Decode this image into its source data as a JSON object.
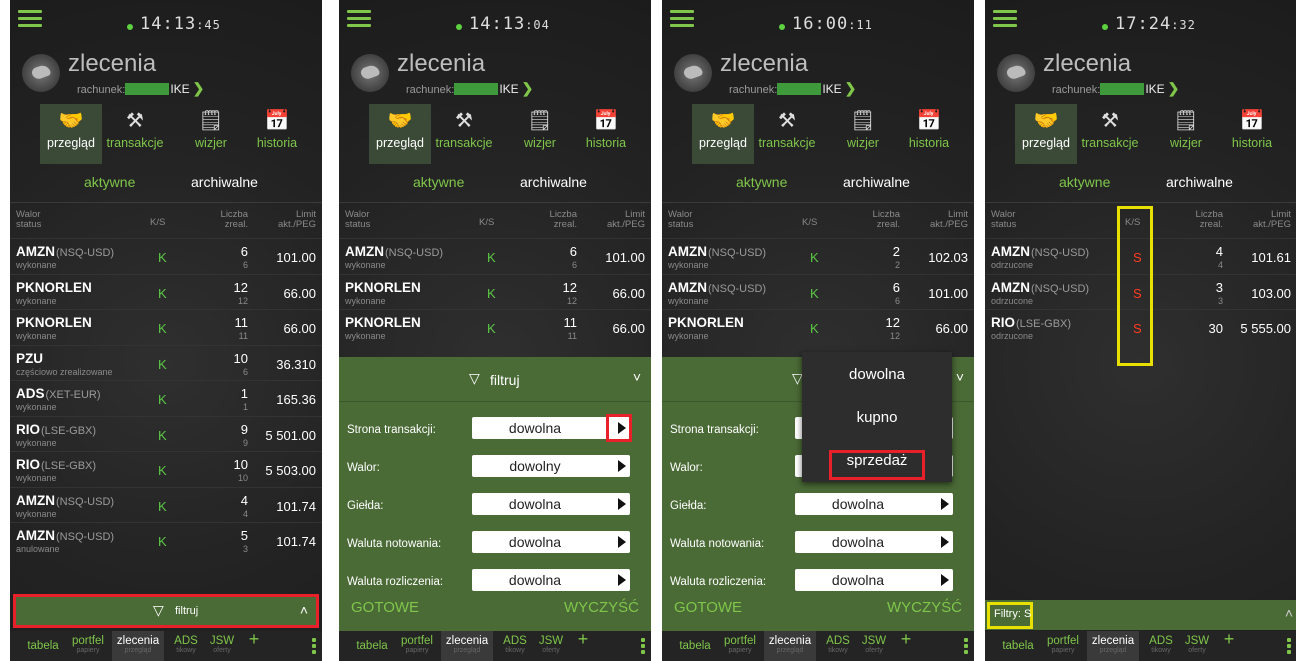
{
  "common": {
    "app_title": "zlecenia",
    "account_label": "rachunek:",
    "account_suffix": "IKE",
    "tabs": [
      {
        "label": "przegląd",
        "icon": "handshake-icon"
      },
      {
        "label": "transakcje",
        "icon": "gavel-icon"
      },
      {
        "label": "wizjer",
        "icon": "document-clock-icon"
      },
      {
        "label": "historia",
        "icon": "calendar-icon"
      }
    ],
    "sub_active": "aktywne",
    "sub_inactive": "archiwalne",
    "headers": {
      "walor": "Walor",
      "status": "status",
      "ks": "K/S",
      "liczba": "Liczba",
      "zreal": "zreal.",
      "limit": "Limit",
      "akt_peg": "akt./PEG"
    },
    "bottom_nav": [
      {
        "main": "tabela",
        "sub": ""
      },
      {
        "main": "portfel",
        "sub": "papiery"
      },
      {
        "main": "zlecenia",
        "sub": "przegląd"
      },
      {
        "main": "ADS",
        "sub": "tikowy"
      },
      {
        "main": "JSW",
        "sub": "oferty"
      },
      {
        "main": "+",
        "sub": ""
      }
    ],
    "filter_label": "filtruj",
    "colors": {
      "accent": "#7fc64a",
      "sell": "#ff3d1f",
      "highlight_red": "#e8202a",
      "highlight_yellow": "#e8e000",
      "filter_bar": "#4a6a36"
    }
  },
  "panels": [
    {
      "clock_main": "14:13",
      "clock_sec": ":45",
      "rows": [
        {
          "name": "AMZN",
          "exchange": "(NSQ-USD)",
          "status": "wykonane",
          "ks": "K",
          "qty": "6",
          "qty_real": "6",
          "limit": "101.00"
        },
        {
          "name": "PKNORLEN",
          "exchange": "",
          "status": "wykonane",
          "ks": "K",
          "qty": "12",
          "qty_real": "12",
          "limit": "66.00"
        },
        {
          "name": "PKNORLEN",
          "exchange": "",
          "status": "wykonane",
          "ks": "K",
          "qty": "11",
          "qty_real": "11",
          "limit": "66.00"
        },
        {
          "name": "PZU",
          "exchange": "",
          "status": "częściowo zrealizowane",
          "ks": "K",
          "qty": "10",
          "qty_real": "6",
          "limit": "36.310"
        },
        {
          "name": "ADS",
          "exchange": "(XET-EUR)",
          "status": "wykonane",
          "ks": "K",
          "qty": "1",
          "qty_real": "1",
          "limit": "165.36"
        },
        {
          "name": "RIO",
          "exchange": "(LSE-GBX)",
          "status": "wykonane",
          "ks": "K",
          "qty": "9",
          "qty_real": "9",
          "limit": "5 501.00"
        },
        {
          "name": "RIO",
          "exchange": "(LSE-GBX)",
          "status": "wykonane",
          "ks": "K",
          "qty": "10",
          "qty_real": "10",
          "limit": "5 503.00"
        },
        {
          "name": "AMZN",
          "exchange": "(NSQ-USD)",
          "status": "wykonane",
          "ks": "K",
          "qty": "4",
          "qty_real": "4",
          "limit": "101.74"
        },
        {
          "name": "AMZN",
          "exchange": "(NSQ-USD)",
          "status": "anulowane",
          "ks": "K",
          "qty": "5",
          "qty_real": "3",
          "limit": "101.74"
        }
      ]
    },
    {
      "clock_main": "14:13",
      "clock_sec": ":04",
      "rows": [
        {
          "name": "AMZN",
          "exchange": "(NSQ-USD)",
          "status": "wykonane",
          "ks": "K",
          "qty": "6",
          "qty_real": "6",
          "limit": "101.00"
        },
        {
          "name": "PKNORLEN",
          "exchange": "",
          "status": "wykonane",
          "ks": "K",
          "qty": "12",
          "qty_real": "12",
          "limit": "66.00"
        },
        {
          "name": "PKNORLEN",
          "exchange": "",
          "status": "wykonane",
          "ks": "K",
          "qty": "11",
          "qty_real": "11",
          "limit": "66.00"
        }
      ],
      "fields": [
        {
          "label": "Strona transakcji:",
          "value": "dowolna"
        },
        {
          "label": "Walor:",
          "value": "dowolny"
        },
        {
          "label": "Giełda:",
          "value": "dowolna"
        },
        {
          "label": "Waluta notowania:",
          "value": "dowolna"
        },
        {
          "label": "Waluta rozliczenia:",
          "value": "dowolna"
        }
      ],
      "done": "GOTOWE",
      "clear": "WYCZYŚĆ"
    },
    {
      "clock_main": "16:00",
      "clock_sec": ":11",
      "rows": [
        {
          "name": "AMZN",
          "exchange": "(NSQ-USD)",
          "status": "wykonane",
          "ks": "K",
          "qty": "2",
          "qty_real": "2",
          "limit": "102.03"
        },
        {
          "name": "AMZN",
          "exchange": "(NSQ-USD)",
          "status": "wykonane",
          "ks": "K",
          "qty": "6",
          "qty_real": "6",
          "limit": "101.00"
        },
        {
          "name": "PKNORLEN",
          "exchange": "",
          "status": "wykonane",
          "ks": "K",
          "qty": "12",
          "qty_real": "12",
          "limit": "66.00"
        }
      ],
      "fields": [
        {
          "label": "Strona transakcji:",
          "value": ""
        },
        {
          "label": "Walor:",
          "value": ""
        },
        {
          "label": "Giełda:",
          "value": "dowolna"
        },
        {
          "label": "Waluta notowania:",
          "value": "dowolna"
        },
        {
          "label": "Waluta rozliczenia:",
          "value": "dowolna"
        }
      ],
      "dropdown": [
        "dowolna",
        "kupno",
        "sprzedaż"
      ],
      "done": "GOTOWE",
      "clear": "WYCZYŚĆ"
    },
    {
      "clock_main": "17:24",
      "clock_sec": ":32",
      "rows": [
        {
          "name": "AMZN",
          "exchange": "(NSQ-USD)",
          "status": "odrzucone",
          "ks": "S",
          "qty": "4",
          "qty_real": "4",
          "limit": "101.61"
        },
        {
          "name": "AMZN",
          "exchange": "(NSQ-USD)",
          "status": "odrzucone",
          "ks": "S",
          "qty": "3",
          "qty_real": "3",
          "limit": "103.00"
        },
        {
          "name": "RIO",
          "exchange": "(LSE-GBX)",
          "status": "odrzucone",
          "ks": "S",
          "qty": "30",
          "qty_real": "",
          "limit": "5 555.00"
        }
      ],
      "filters_label": "Filtry:",
      "filters_value": "S"
    }
  ]
}
